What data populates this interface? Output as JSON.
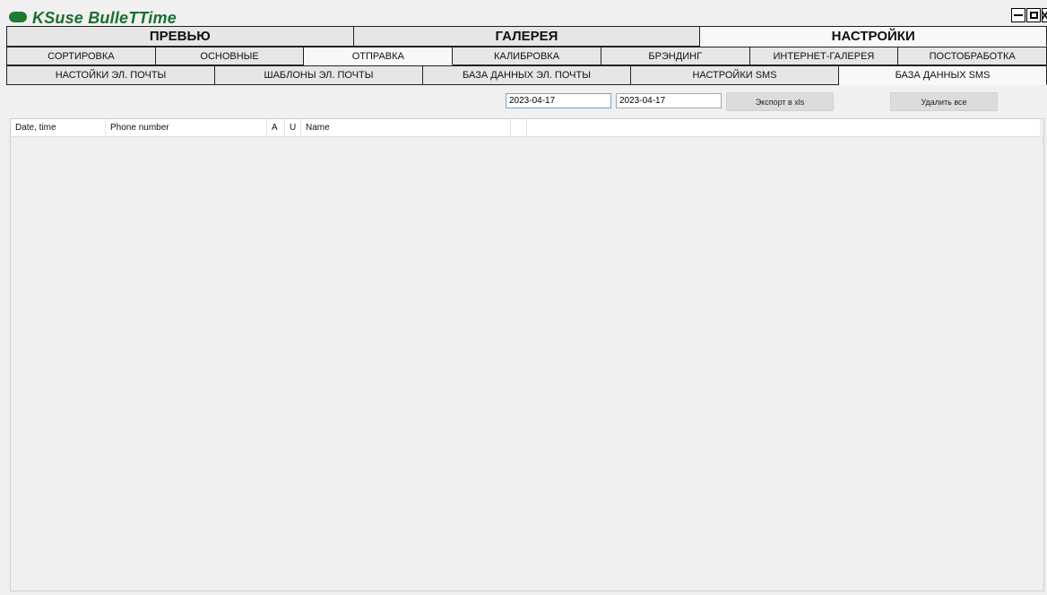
{
  "app": {
    "title": "KSuse BulleTTime"
  },
  "main_tabs": [
    {
      "label": "ПРЕВЬЮ",
      "active": false
    },
    {
      "label": "ГАЛЕРЕЯ",
      "active": false
    },
    {
      "label": "НАСТРОЙКИ",
      "active": true
    }
  ],
  "settings_tabs": [
    {
      "label": "СОРТИРОВКА",
      "active": false
    },
    {
      "label": "ОСНОВНЫЕ",
      "active": false
    },
    {
      "label": "ОТПРАВКА",
      "active": true
    },
    {
      "label": "КАЛИБРОВКА",
      "active": false
    },
    {
      "label": "БРЭНДИНГ",
      "active": false
    },
    {
      "label": "ИНТЕРНЕТ-ГАЛЕРЕЯ",
      "active": false
    },
    {
      "label": "ПОСТОБРАБОТКА",
      "active": false
    }
  ],
  "send_tabs": [
    {
      "label": "НАСТОЙКИ ЭЛ. ПОЧТЫ",
      "active": false
    },
    {
      "label": "ШАБЛОНЫ ЭЛ. ПОЧТЫ",
      "active": false
    },
    {
      "label": "БАЗА ДАННЫХ ЭЛ. ПОЧТЫ",
      "active": false
    },
    {
      "label": "НАСТРОЙКИ SMS",
      "active": false
    },
    {
      "label": "БАЗА ДАННЫХ SMS",
      "active": true
    }
  ],
  "toolbar": {
    "date_from": "2023-04-17",
    "date_to": "2023-04-17",
    "export_label": "Экспорт в xls",
    "delete_label": "Удалить все"
  },
  "grid": {
    "columns": [
      "Date, time",
      "Phone number",
      "A",
      "U",
      "Name",
      "",
      ""
    ],
    "rows": []
  }
}
